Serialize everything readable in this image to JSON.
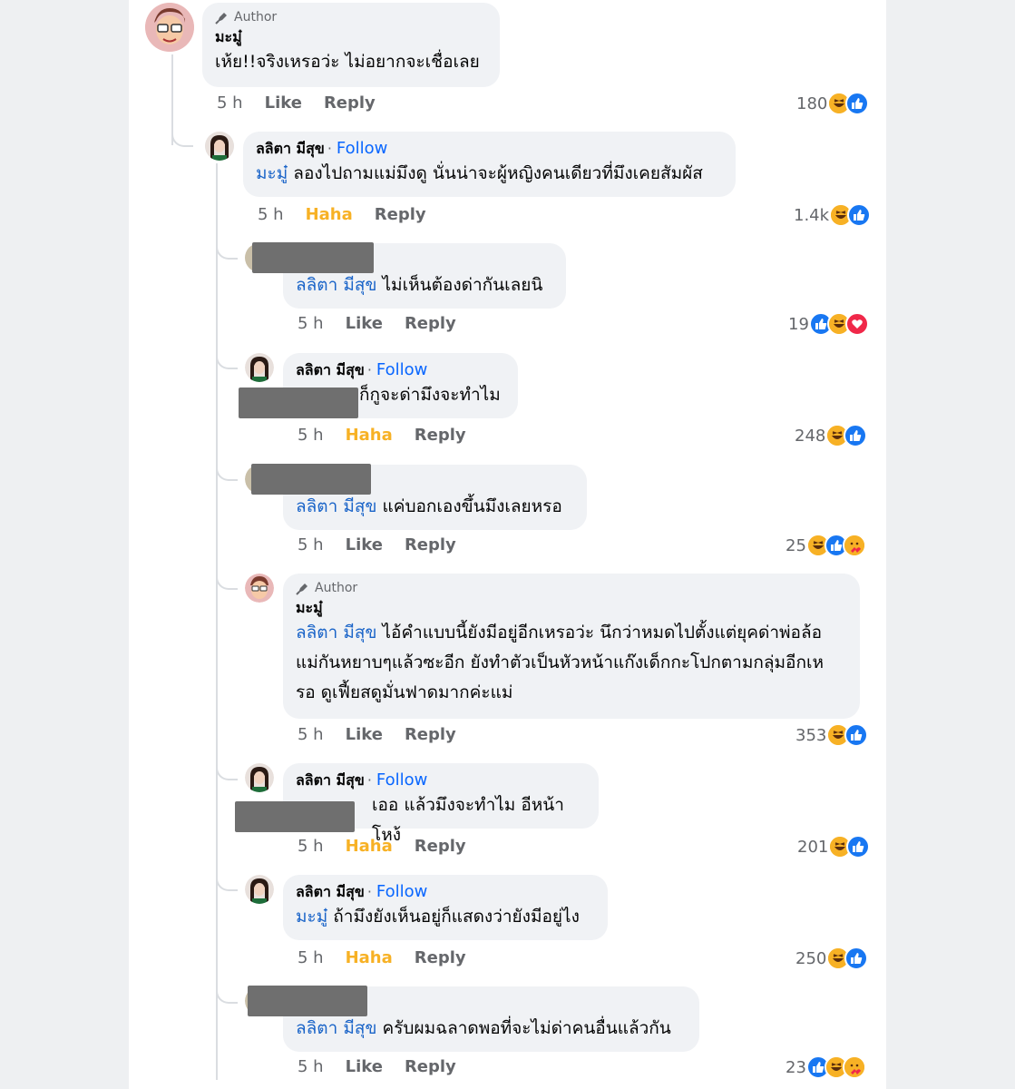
{
  "labels": {
    "author": "Author",
    "follow": "Follow",
    "like": "Like",
    "reply": "Reply",
    "haha": "Haha",
    "time": "5 h"
  },
  "colors": {
    "follow": "#0866ff",
    "mention": "#1a64c8",
    "haha": "#f7b125",
    "like_blue": "#1877f2",
    "love_red": "#f02849"
  },
  "comments": [
    {
      "author_badge": "Author",
      "name": "มะมู๋",
      "text": "เห้ย!!จริงเหรอว่ะ ไม่อยากจะเชื่อเลย",
      "time": "5 h",
      "action": "Like",
      "reply": "Reply",
      "count": "180",
      "reactions": [
        "haha-icon",
        "like-icon"
      ]
    },
    {
      "name": "ลลิตา มีสุข",
      "follow": "Follow",
      "mention": "มะมู๋",
      "text": " ลองไปถามแม่มึงดู นั่นน่าจะผู้หญิงคนเดียวที่มึงเคยสัมผัส",
      "time": "5 h",
      "action": "Haha",
      "reply": "Reply",
      "count": "1.4k",
      "reactions": [
        "haha-icon",
        "like-icon"
      ]
    },
    {
      "mention": "ลลิตา มีสุข",
      "text": " ไม่เห็นต้องด่ากันเลยนิ",
      "time": "5 h",
      "action": "Like",
      "reply": "Reply",
      "count": "19",
      "reactions": [
        "like-icon",
        "haha-icon",
        "love-icon"
      ]
    },
    {
      "name": "ลลิตา มีสุข",
      "follow": "Follow",
      "text": "ก็กูจะด่ามึงจะทำไม",
      "time": "5 h",
      "action": "Haha",
      "reply": "Reply",
      "count": "248",
      "reactions": [
        "haha-icon",
        "like-icon"
      ]
    },
    {
      "mention": "ลลิตา มีสุข",
      "text": " แค่บอกเองขึ้นมึงเลยหรอ",
      "time": "5 h",
      "action": "Like",
      "reply": "Reply",
      "count": "25",
      "reactions": [
        "haha-icon",
        "like-icon",
        "care-icon"
      ]
    },
    {
      "author_badge": "Author",
      "name": "มะมู๋",
      "mention": "ลลิตา มีสุข",
      "text_lines": [
        " ไอ้คำแบบนี้ยังมีอยู่อีกเหรอว่ะ นึกว่าหมดไปตั้งแต่ยุคด่าพ่อล้อ",
        "แม่กันหยาบๆแล้วซะอีก ยังทำตัวเป็นหัวหน้าแก๊งเด็กกะโปกตามกลุ่มอีกเห",
        "รอ ดูเฟี้ยสดูมั่นฟาดมากค่ะแม่"
      ],
      "time": "5 h",
      "action": "Like",
      "reply": "Reply",
      "count": "353",
      "reactions": [
        "haha-icon",
        "like-icon"
      ]
    },
    {
      "name": "ลลิตา มีสุข",
      "follow": "Follow",
      "text": "เออ แล้วมึงจะทำไม อีหน้าโหง้",
      "time": "5 h",
      "action": "Haha",
      "reply": "Reply",
      "count": "201",
      "reactions": [
        "haha-icon",
        "like-icon"
      ]
    },
    {
      "name": "ลลิตา มีสุข",
      "follow": "Follow",
      "mention": "มะมู๋",
      "text": " ถ้ามึงยังเห็นอยู่ก็แสดงว่ายังมีอยู่ไง",
      "time": "5 h",
      "action": "Haha",
      "reply": "Reply",
      "count": "250",
      "reactions": [
        "haha-icon",
        "like-icon"
      ]
    },
    {
      "mention": "ลลิตา มีสุข",
      "text": " ครับผมฉลาดพอที่จะไม่ด่าคนอื่นแล้วกัน",
      "time": "5 h",
      "action": "Like",
      "reply": "Reply",
      "count": "23",
      "reactions": [
        "like-icon",
        "haha-icon",
        "care-icon"
      ]
    }
  ]
}
